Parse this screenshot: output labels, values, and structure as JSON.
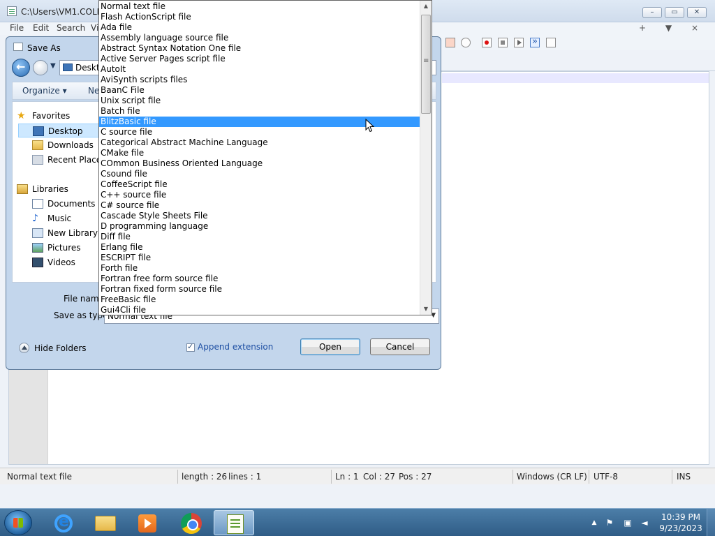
{
  "app": {
    "title": "C:\\Users\\VM1.COLLA",
    "menu": [
      "File",
      "Edit",
      "Search",
      "Vi"
    ],
    "right_tools": "+ ▼ ×",
    "window_buttons": [
      "–",
      "▭",
      "✕"
    ]
  },
  "dialog": {
    "title": "Save As",
    "address": "Deskto",
    "organize": "Organize ▾",
    "new_folder": "Ne",
    "tree": {
      "favorites": "Favorites",
      "desktop": "Desktop",
      "downloads": "Downloads",
      "recent_places": "Recent Places",
      "libraries": "Libraries",
      "documents": "Documents",
      "music": "Music",
      "new_library": "New Library",
      "pictures": "Pictures",
      "videos": "Videos"
    },
    "file_name_label": "File name:",
    "save_as_type_label": "Save as type:",
    "save_as_type_value": "Normal text file",
    "hide_folders": "Hide Folders",
    "append_extension": "Append extension",
    "append_extension_checked": true,
    "open_button": "Open",
    "cancel_button": "Cancel"
  },
  "dropdown": {
    "items": [
      "Normal text file",
      "Flash ActionScript file",
      "Ada file",
      "Assembly language source file",
      "Abstract Syntax Notation One file",
      "Active Server Pages script file",
      "AutoIt",
      "AviSynth scripts files",
      "BaanC File",
      "Unix script file",
      "Batch file",
      "BlitzBasic file",
      "C source file",
      "Categorical Abstract Machine Language",
      "CMake file",
      "COmmon Business Oriented Language",
      "Csound file",
      "CoffeeScript file",
      "C++ source file",
      "C# source file",
      "Cascade Style Sheets File",
      "D programming language",
      "Diff file",
      "Erlang file",
      "ESCRIPT file",
      "Forth file",
      "Fortran free form source file",
      "Fortran fixed form source file",
      "FreeBasic file",
      "Gui4Cli file"
    ],
    "selected_index": 11,
    "highlight_color": "#3399ff"
  },
  "statusbar": {
    "file_type": "Normal text file",
    "length": "length : 26",
    "lines": "lines : 1",
    "ln": "Ln : 1",
    "col": "Col : 27",
    "pos": "Pos : 27",
    "eol": "Windows (CR LF)",
    "encoding": "UTF-8",
    "mode": "INS"
  },
  "taskbar": {
    "apps": [
      "internet-explorer",
      "file-explorer",
      "media-player",
      "chrome",
      "notepad-plus-plus"
    ],
    "active_app": "notepad-plus-plus",
    "time": "10:39 PM",
    "date": "9/23/2023"
  }
}
